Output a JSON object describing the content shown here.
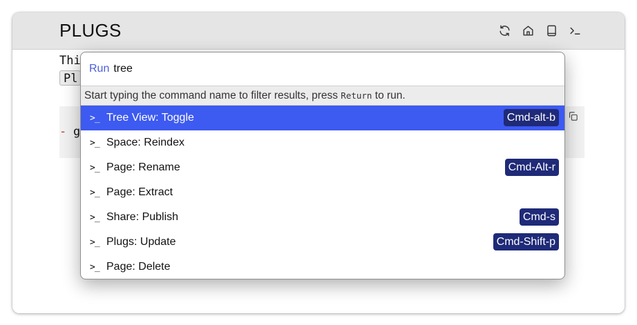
{
  "header": {
    "title": "PLUGS"
  },
  "toolbar": {
    "icons": [
      "sync-icon",
      "home-icon",
      "book-icon",
      "terminal-icon"
    ]
  },
  "editor": {
    "line1_text": "Thi",
    "pill_text": "Pl",
    "code_dash": "-",
    "code_text": "g"
  },
  "palette": {
    "run_label": "Run",
    "search_value": "tree",
    "hint_before": "Start typing the command name to filter results, press ",
    "hint_key": "Return",
    "hint_after": " to run.",
    "option_icon": ">_",
    "options": [
      {
        "label": "Tree View: Toggle",
        "shortcut": "Cmd-alt-b",
        "selected": true
      },
      {
        "label": "Space: Reindex",
        "shortcut": ""
      },
      {
        "label": "Page: Rename",
        "shortcut": "Cmd-Alt-r"
      },
      {
        "label": "Page: Extract",
        "shortcut": ""
      },
      {
        "label": "Share: Publish",
        "shortcut": "Cmd-s"
      },
      {
        "label": "Plugs: Update",
        "shortcut": "Cmd-Shift-p"
      },
      {
        "label": "Page: Delete",
        "shortcut": ""
      }
    ]
  },
  "colors": {
    "accent": "#3d5af1",
    "shortcut_bg": "#1f2a78",
    "run_label": "#4a5fd8",
    "topbar_bg": "#e5e5e5"
  }
}
